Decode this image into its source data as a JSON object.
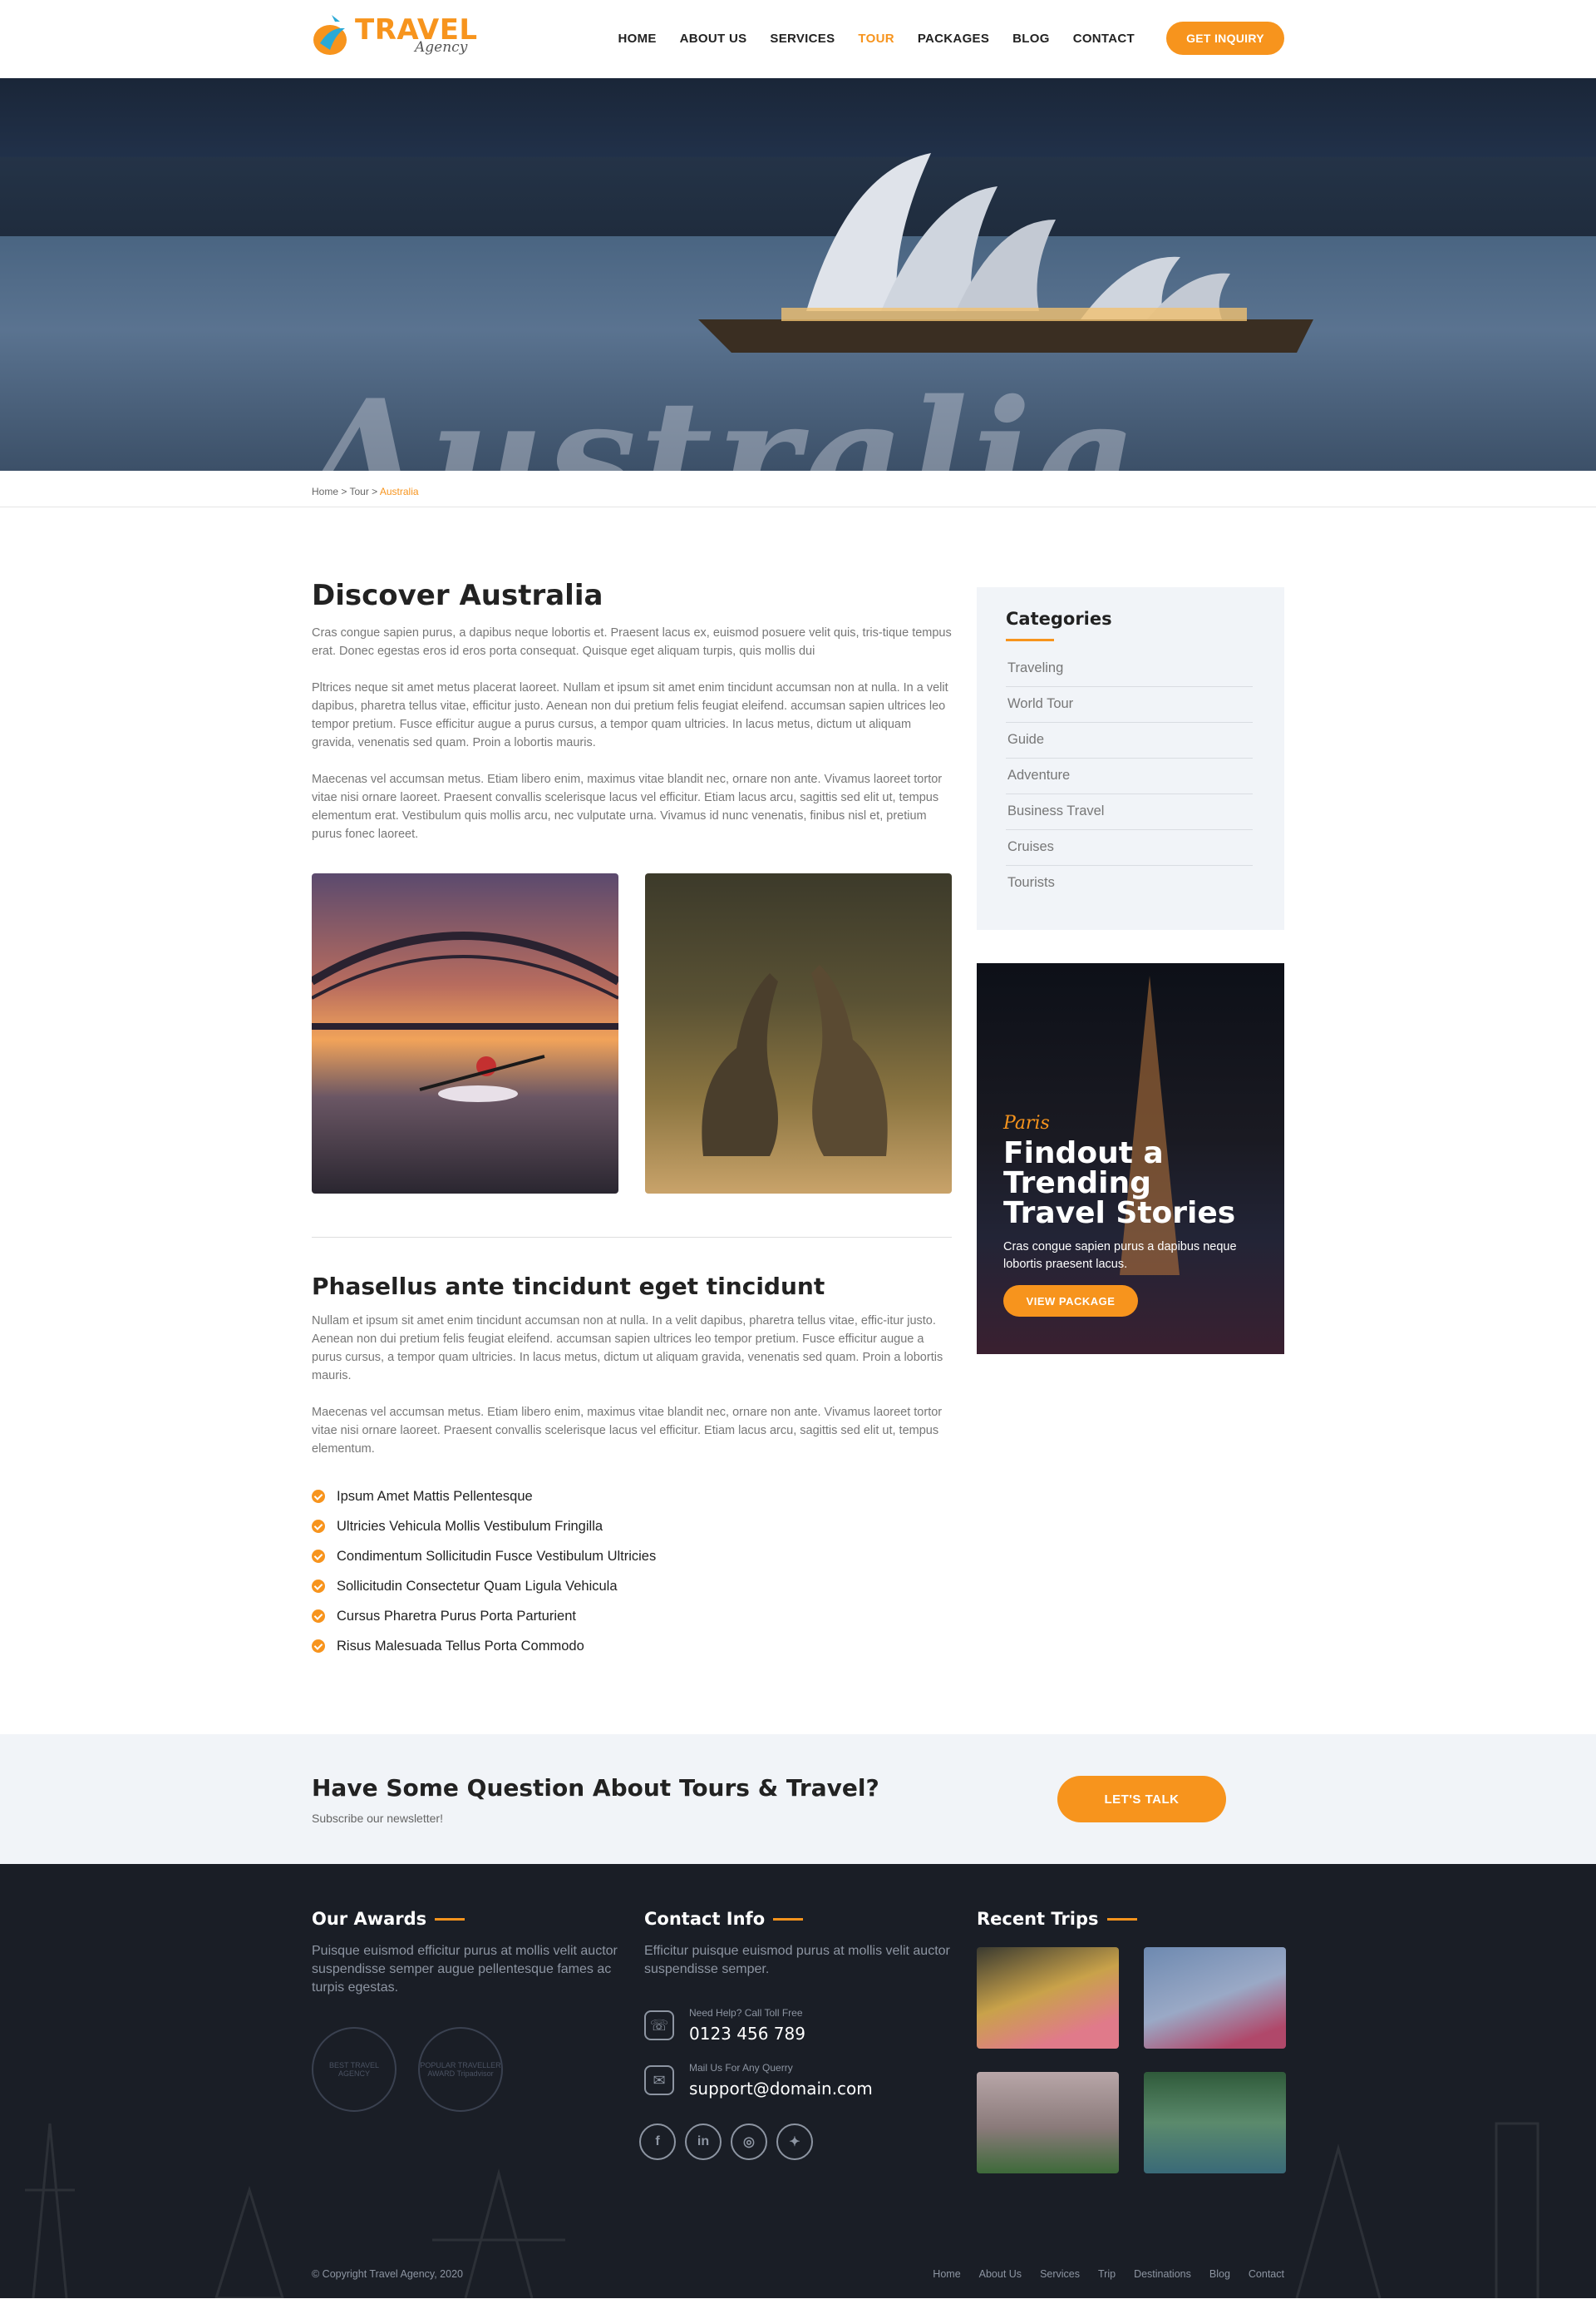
{
  "brand": {
    "title": "TRAVEL",
    "subtitle": "Agency"
  },
  "nav": {
    "items": [
      "HOME",
      "ABOUT US",
      "SERVICES",
      "TOUR",
      "PACKAGES",
      "BLOG",
      "CONTACT"
    ],
    "active": "TOUR",
    "cta": "GET INQUIRY"
  },
  "hero": {
    "word": "Australia"
  },
  "breadcrumb": {
    "home": "Home",
    "sep1": " > ",
    "tour": "Tour",
    "sep2": " > ",
    "current": "Australia"
  },
  "main": {
    "title": "Discover Australia",
    "p1": "Cras congue sapien purus, a dapibus neque lobortis et. Praesent lacus ex, euismod posuere velit quis, tris-tique tempus erat. Donec egestas eros id eros porta consequat. Quisque eget aliquam turpis, quis mollis dui",
    "p2": "Pltrices neque sit amet metus placerat laoreet. Nullam et ipsum sit amet enim tincidunt accumsan non at nulla. In a velit dapibus, pharetra tellus vitae, efficitur justo. Aenean non dui pretium felis feugiat eleifend. accumsan sapien ultrices leo tempor pretium. Fusce efficitur augue a purus cursus, a tempor quam ultricies. In lacus metus, dictum ut aliquam gravida, venenatis sed quam. Proin a lobortis mauris.",
    "p3": "Maecenas vel accumsan metus. Etiam libero enim, maximus vitae blandit nec, ornare non ante. Vivamus laoreet tortor vitae nisi ornare laoreet. Praesent convallis scelerisque lacus vel efficitur. Etiam lacus arcu, sagittis sed elit ut, tempus elementum erat. Vestibulum quis mollis arcu, nec vulputate urna. Vivamus id nunc venenatis, finibus nisl et, pretium purus fonec laoreet.",
    "subtitle": "Phasellus ante tincidunt eget tincidunt",
    "p4": "Nullam et ipsum sit amet enim tincidunt accumsan non at nulla. In a velit dapibus, pharetra tellus vitae, effic-itur justo. Aenean non dui pretium felis feugiat eleifend. accumsan sapien ultrices leo tempor pretium. Fusce efficitur augue a purus cursus, a tempor quam ultricies. In lacus metus, dictum ut aliquam gravida, venenatis sed quam. Proin a lobortis mauris.",
    "p5": "Maecenas vel accumsan metus. Etiam libero enim, maximus vitae blandit nec, ornare non ante. Vivamus laoreet tortor vitae nisi ornare laoreet. Praesent convallis scelerisque lacus vel efficitur. Etiam lacus arcu, sagittis sed elit ut, tempus elementum.",
    "checklist": [
      "Ipsum Amet Mattis Pellentesque",
      "Ultricies Vehicula Mollis Vestibulum Fringilla",
      "Condimentum Sollicitudin Fusce Vestibulum Ultricies",
      "Sollicitudin Consectetur Quam Ligula Vehicula",
      "Cursus Pharetra Purus Porta Parturient",
      "Risus Malesuada Tellus Porta Commodo"
    ]
  },
  "sidebar": {
    "categories_title": "Categories",
    "categories": [
      "Traveling",
      "World Tour",
      "Guide",
      "Adventure",
      "Business Travel",
      "Cruises",
      "Tourists"
    ],
    "promo": {
      "kicker": "Paris",
      "title": "Findout a Trending Travel Stories",
      "text": "Cras congue sapien purus a dapibus neque lobortis praesent lacus.",
      "button": "VIEW PACKAGE"
    }
  },
  "cta": {
    "title": "Have Some Question About Tours & Travel?",
    "subtitle": "Subscribe our newsletter!",
    "button": "LET'S TALK"
  },
  "footer": {
    "awards": {
      "title": "Our Awards",
      "text": "Puisque euismod efficitur purus at mollis velit auctor suspendisse semper augue pellentesque fames ac turpis egestas.",
      "badge1": "BEST TRAVEL AGENCY",
      "badge2": "POPULAR TRAVELLER AWARD Tripadvisor"
    },
    "contact": {
      "title": "Contact Info",
      "text": "Efficitur puisque euismod purus at mollis velit auctor suspendisse semper.",
      "phone_label": "Need Help? Call Toll Free",
      "phone": "0123 456 789",
      "mail_label": "Mail Us For Any Querry",
      "email": "support@domain.com"
    },
    "trips": {
      "title": "Recent Trips"
    },
    "copyright": "© Copyright Travel Agency, 2020",
    "links": [
      "Home",
      "About Us",
      "Services",
      "Trip",
      "Destinations",
      "Blog",
      "Contact"
    ]
  },
  "colors": {
    "accent": "#f7941d",
    "dark": "#1a1e26",
    "light_bg": "#f1f4f8"
  }
}
